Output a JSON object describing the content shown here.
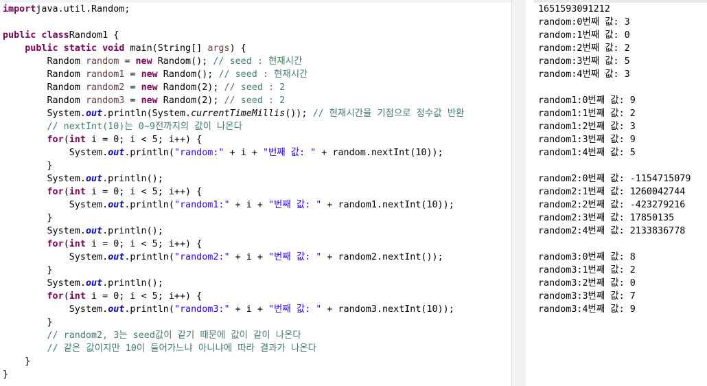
{
  "editor": {
    "lines": [
      [
        [
          "kw",
          "import"
        ],
        [
          "",
          "java.util.Random;"
        ]
      ],
      [],
      [
        [
          "kw",
          "public class"
        ],
        [
          "",
          "Random1 {"
        ]
      ],
      [
        [
          "",
          "    "
        ],
        [
          "kw",
          "public static void"
        ],
        [
          "",
          " main(String[] "
        ],
        [
          "vr",
          "args"
        ],
        [
          "",
          ") {"
        ]
      ],
      [
        [
          "",
          "        Random "
        ],
        [
          "vr",
          "random"
        ],
        [
          "",
          " = "
        ],
        [
          "kw",
          "new"
        ],
        [
          "",
          " Random(); "
        ],
        [
          "cm",
          "// seed : 현재시간"
        ]
      ],
      [
        [
          "",
          "        Random "
        ],
        [
          "vr",
          "random1"
        ],
        [
          "",
          " = "
        ],
        [
          "kw",
          "new"
        ],
        [
          "",
          " Random(); "
        ],
        [
          "cm",
          "// seed : 현재시간"
        ]
      ],
      [
        [
          "",
          "        Random "
        ],
        [
          "vr",
          "random2"
        ],
        [
          "",
          " = "
        ],
        [
          "kw",
          "new"
        ],
        [
          "",
          " Random(2); "
        ],
        [
          "cm",
          "// seed : 2"
        ]
      ],
      [
        [
          "",
          "        Random "
        ],
        [
          "vr",
          "random3"
        ],
        [
          "",
          " = "
        ],
        [
          "kw",
          "new"
        ],
        [
          "",
          " Random(2); "
        ],
        [
          "cm",
          "// seed : 2"
        ]
      ],
      [
        [
          "",
          "        System."
        ],
        [
          "fd",
          "out"
        ],
        [
          "",
          ".println(System."
        ],
        [
          "it",
          "currentTimeMillis"
        ],
        [
          "",
          "()); "
        ],
        [
          "cm",
          "// 현재시간을 기점으로 정수값 반환"
        ]
      ],
      [
        [
          "cm",
          "        // nextInt(10)는 0~9전까지의 값이 나온다"
        ]
      ],
      [
        [
          "",
          "        "
        ],
        [
          "kw",
          "for"
        ],
        [
          "",
          "("
        ],
        [
          "kw",
          "int"
        ],
        [
          "",
          " i = 0; i < 5; i++) {"
        ]
      ],
      [
        [
          "",
          "            System."
        ],
        [
          "fd",
          "out"
        ],
        [
          "",
          ".println("
        ],
        [
          "st",
          "\"random:\""
        ],
        [
          "",
          " + i + "
        ],
        [
          "st",
          "\"번째 값: \""
        ],
        [
          "",
          " + random.nextInt(10));"
        ]
      ],
      [
        [
          "",
          "        }"
        ]
      ],
      [
        [
          "",
          "        System."
        ],
        [
          "fd",
          "out"
        ],
        [
          "",
          ".println();"
        ]
      ],
      [
        [
          "",
          "        "
        ],
        [
          "kw",
          "for"
        ],
        [
          "",
          "("
        ],
        [
          "kw",
          "int"
        ],
        [
          "",
          " i = 0; i < 5; i++) {"
        ]
      ],
      [
        [
          "",
          "            System."
        ],
        [
          "fd",
          "out"
        ],
        [
          "",
          ".println("
        ],
        [
          "st",
          "\"random1:\""
        ],
        [
          "",
          " + i + "
        ],
        [
          "st",
          "\"번째 값: \""
        ],
        [
          "",
          " + random1.nextInt(10));"
        ]
      ],
      [
        [
          "",
          "        }"
        ]
      ],
      [
        [
          "",
          "        System."
        ],
        [
          "fd",
          "out"
        ],
        [
          "",
          ".println();"
        ]
      ],
      [
        [
          "",
          "        "
        ],
        [
          "kw",
          "for"
        ],
        [
          "",
          "("
        ],
        [
          "kw",
          "int"
        ],
        [
          "",
          " i = 0; i < 5; i++) {"
        ]
      ],
      [
        [
          "",
          "            System."
        ],
        [
          "fd",
          "out"
        ],
        [
          "",
          ".println("
        ],
        [
          "st",
          "\"random2:\""
        ],
        [
          "",
          " + i + "
        ],
        [
          "st",
          "\"번째 값: \""
        ],
        [
          "",
          " + random2.nextInt());"
        ]
      ],
      [
        [
          "",
          "        }"
        ]
      ],
      [
        [
          "",
          "        System."
        ],
        [
          "fd",
          "out"
        ],
        [
          "",
          ".println();"
        ]
      ],
      [
        [
          "",
          "        "
        ],
        [
          "kw",
          "for"
        ],
        [
          "",
          "("
        ],
        [
          "kw",
          "int"
        ],
        [
          "",
          " i = 0; i < 5; i++) {"
        ]
      ],
      [
        [
          "",
          "            System."
        ],
        [
          "fd",
          "out"
        ],
        [
          "",
          ".println("
        ],
        [
          "st",
          "\"random3:\""
        ],
        [
          "",
          " + i + "
        ],
        [
          "st",
          "\"번째 값: \""
        ],
        [
          "",
          " + random3.nextInt(10));"
        ]
      ],
      [
        [
          "",
          "        }"
        ]
      ],
      [
        [
          "cm",
          "        // random2, 3는 seed값이 같기 때문에 값이 같이 나온다"
        ]
      ],
      [
        [
          "cm",
          "        // 같은 값이지만 10이 들어가느냐 아니냐에 따라 결과가 나온다"
        ]
      ],
      [
        [
          "",
          "    }"
        ]
      ],
      [
        [
          "",
          "}"
        ]
      ]
    ]
  },
  "console": {
    "lines": [
      "1651593091212",
      "random:0번째 값: 3",
      "random:1번째 값: 0",
      "random:2번째 값: 2",
      "random:3번째 값: 5",
      "random:4번째 값: 3",
      "",
      "random1:0번째 값: 9",
      "random1:1번째 값: 2",
      "random1:2번째 값: 3",
      "random1:3번째 값: 9",
      "random1:4번째 값: 5",
      "",
      "random2:0번째 값: -1154715079",
      "random2:1번째 값: 1260042744",
      "random2:2번째 값: -423279216",
      "random2:3번째 값: 17850135",
      "random2:4번째 값: 2133836778",
      "",
      "random3:0번째 값: 8",
      "random3:1번째 값: 2",
      "random3:2번째 값: 0",
      "random3:3번째 값: 7",
      "random3:4번째 값: 9"
    ]
  }
}
